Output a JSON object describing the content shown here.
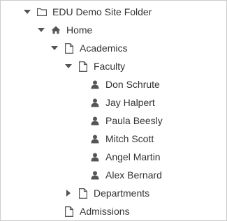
{
  "tree": {
    "root": {
      "label": "EDU Demo Site Folder",
      "icon": "folder-icon",
      "expanded": true
    },
    "home": {
      "label": "Home",
      "icon": "home-icon",
      "expanded": true
    },
    "academics": {
      "label": "Academics",
      "icon": "page-icon",
      "expanded": true
    },
    "faculty": {
      "label": "Faculty",
      "icon": "page-icon",
      "expanded": true,
      "members": [
        {
          "label": "Don Schrute",
          "icon": "user-icon"
        },
        {
          "label": "Jay Halpert",
          "icon": "user-icon"
        },
        {
          "label": "Paula Beesly",
          "icon": "user-icon"
        },
        {
          "label": "Mitch Scott",
          "icon": "user-icon"
        },
        {
          "label": "Angel Martin",
          "icon": "user-icon"
        },
        {
          "label": "Alex Bernard",
          "icon": "user-icon"
        }
      ]
    },
    "departments": {
      "label": "Departments",
      "icon": "page-icon",
      "expanded": false
    },
    "admissions": {
      "label": "Admissions",
      "icon": "page-icon"
    }
  },
  "colors": {
    "text": "#333333",
    "icon": "#555555",
    "border": "#cccccc",
    "background": "#ffffff"
  }
}
